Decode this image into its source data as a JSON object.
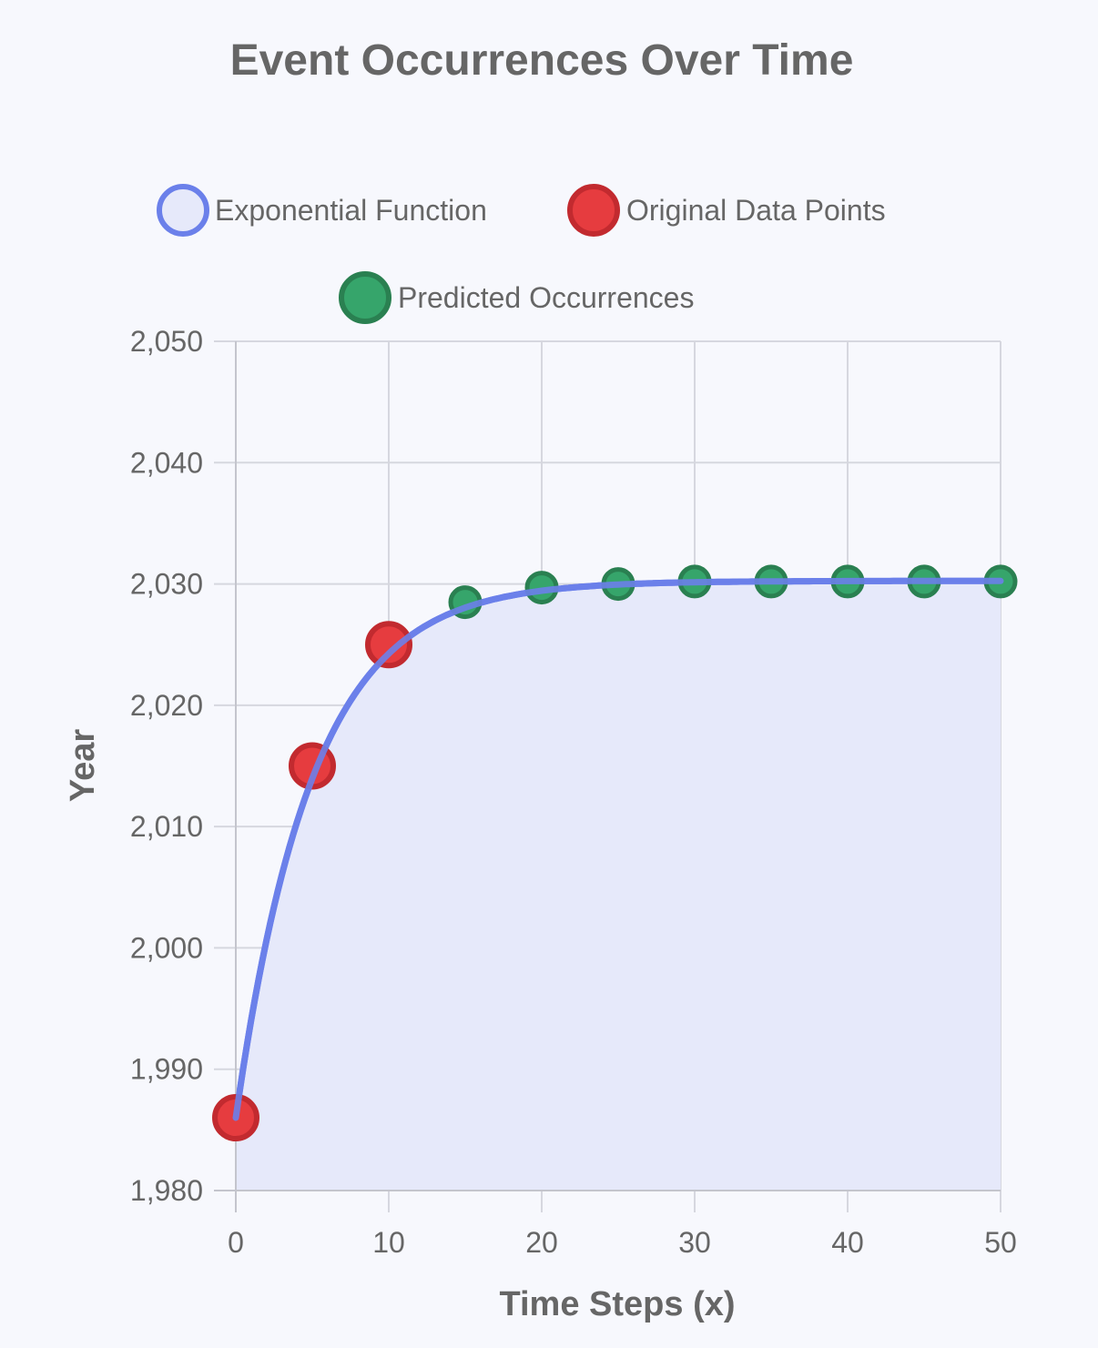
{
  "chart_data": {
    "type": "line",
    "title": "Event Occurrences Over Time",
    "xlabel": "Time Steps (x)",
    "ylabel": "Year",
    "xlim": [
      0,
      50
    ],
    "ylim": [
      1980,
      2050
    ],
    "x_ticks": [
      "0",
      "10",
      "20",
      "30",
      "40",
      "50"
    ],
    "y_ticks": [
      "2,050",
      "2,040",
      "2,030",
      "2,020",
      "2,010",
      "2,000",
      "1,990",
      "1,980"
    ],
    "grid": true,
    "legend_position": "top",
    "series": [
      {
        "name": "Exponential Function",
        "kind": "area-line",
        "color": "#6b80ea",
        "fill": "#e6e9fa",
        "curve": {
          "form": "y = 2030.25 - 44.25 * exp(-0.2 * x)",
          "a": 2030.25,
          "b": 44.25,
          "k": 0.2
        }
      },
      {
        "name": "Original Data Points",
        "kind": "scatter",
        "color": "#e63c3f",
        "stroke": "#c22a2f",
        "points": [
          {
            "x": 0,
            "y": 1986
          },
          {
            "x": 5,
            "y": 2015
          },
          {
            "x": 10,
            "y": 2025
          }
        ]
      },
      {
        "name": "Predicted Occurrences",
        "kind": "scatter",
        "color": "#36a56b",
        "stroke": "#2a8051",
        "points": [
          {
            "x": 15,
            "y": 2028.5
          },
          {
            "x": 20,
            "y": 2029.7
          },
          {
            "x": 25,
            "y": 2030.0
          },
          {
            "x": 30,
            "y": 2030.2
          },
          {
            "x": 35,
            "y": 2030.2
          },
          {
            "x": 40,
            "y": 2030.2
          },
          {
            "x": 45,
            "y": 2030.2
          },
          {
            "x": 50,
            "y": 2030.2
          }
        ]
      }
    ]
  }
}
